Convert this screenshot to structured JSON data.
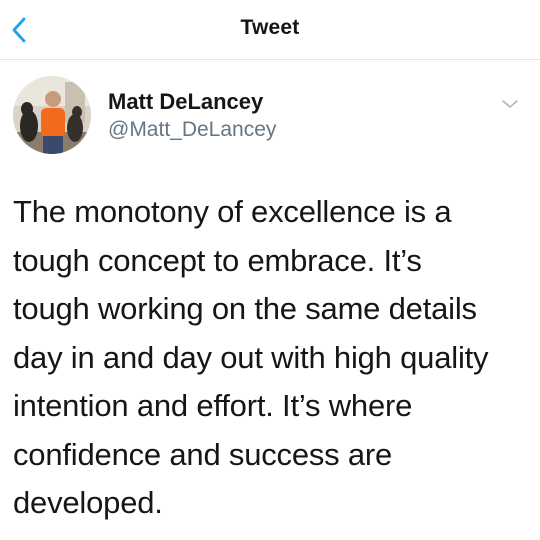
{
  "nav": {
    "title": "Tweet",
    "back_icon": "chevron-left-icon",
    "accent_color": "#1da1f2"
  },
  "tweet": {
    "author_name": "Matt DeLancey",
    "author_handle": "@Matt_DeLancey",
    "avatar_icon": "profile-photo",
    "more_icon": "chevron-down-icon",
    "lines": [
      "The monotony of excellence is a",
      "tough concept to embrace. It’s",
      "tough working on the same details",
      "day in and day out with high quality",
      "intention and effort. It’s where",
      "confidence and success are",
      "developed."
    ]
  },
  "colors": {
    "text_primary": "#14171a",
    "text_secondary": "#657786",
    "divider": "#e1e6ea"
  }
}
